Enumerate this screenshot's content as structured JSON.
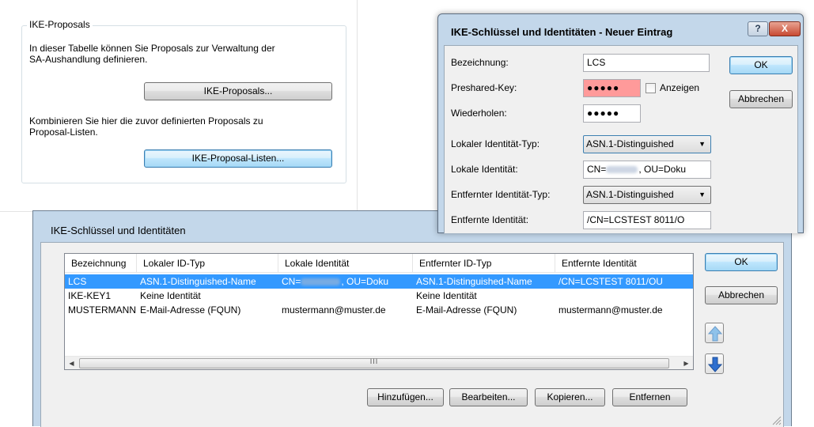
{
  "background_panel": {
    "group_title": "IKE-Proposals",
    "text1_line1": "In dieser Tabelle können Sie Proposals zur Verwaltung der",
    "text1_line2": "SA-Aushandlung definieren.",
    "proposals_button": "IKE-Proposals...",
    "text2_line1": "Kombinieren Sie hier die zuvor definierten Proposals zu",
    "text2_line2": "Proposal-Listen.",
    "proposal_lists_button": "IKE-Proposal-Listen..."
  },
  "main_dialog": {
    "title": "IKE-Schlüssel und Identitäten",
    "columns": [
      "Bezeichnung",
      "Lokaler ID-Typ",
      "Lokale Identität",
      "Entfernter ID-Typ",
      "Entfernte Identität"
    ],
    "rows": [
      {
        "name": "LCS",
        "local_type": "ASN.1-Distinguished-Name",
        "local_id_prefix": "CN=",
        "local_id_suffix": ", OU=Doku",
        "remote_type": "ASN.1-Distinguished-Name",
        "remote_id": "/CN=LCSTEST 8011/OU",
        "selected": true
      },
      {
        "name": "IKE-KEY1",
        "local_type": "Keine Identität",
        "local_id_prefix": "",
        "local_id_suffix": "",
        "remote_type": "Keine Identität",
        "remote_id": "",
        "selected": false
      },
      {
        "name": "MUSTERMANN",
        "local_type": "E-Mail-Adresse (FQUN)",
        "local_id_prefix": "mustermann@muster.de",
        "local_id_suffix": "",
        "remote_type": "E-Mail-Adresse (FQUN)",
        "remote_id": "mustermann@muster.de",
        "selected": false
      }
    ],
    "scroll_mark": "III",
    "buttons": {
      "ok": "OK",
      "cancel": "Abbrechen",
      "add": "Hinzufügen...",
      "edit": "Bearbeiten...",
      "copy": "Kopieren...",
      "remove": "Entfernen"
    }
  },
  "entry_dialog": {
    "title": "IKE-Schlüssel und Identitäten - Neuer Eintrag",
    "help_glyph": "?",
    "close_glyph": "X",
    "labels": {
      "name": "Bezeichnung:",
      "psk": "Preshared-Key:",
      "repeat": "Wiederholen:",
      "local_type": "Lokaler Identität-Typ:",
      "local_id": "Lokale Identität:",
      "remote_type": "Entfernter Identität-Typ:",
      "remote_id": "Entfernte Identität:"
    },
    "values": {
      "name": "LCS",
      "psk": "●●●●●",
      "repeat": "●●●●●",
      "local_type": "ASN.1-Distinguished",
      "local_id_prefix": "CN=",
      "local_id_suffix": ", OU=Doku",
      "remote_type": "ASN.1-Distinguished",
      "remote_id": "/CN=LCSTEST 8011/O"
    },
    "show_checkbox": "Anzeigen",
    "ok": "OK",
    "cancel": "Abbrechen"
  },
  "colors": {
    "dialog_frame": "#c3d7ea",
    "selection": "#3399ff",
    "error_field": "#ff9a9a",
    "close_button": "#c84a33"
  }
}
